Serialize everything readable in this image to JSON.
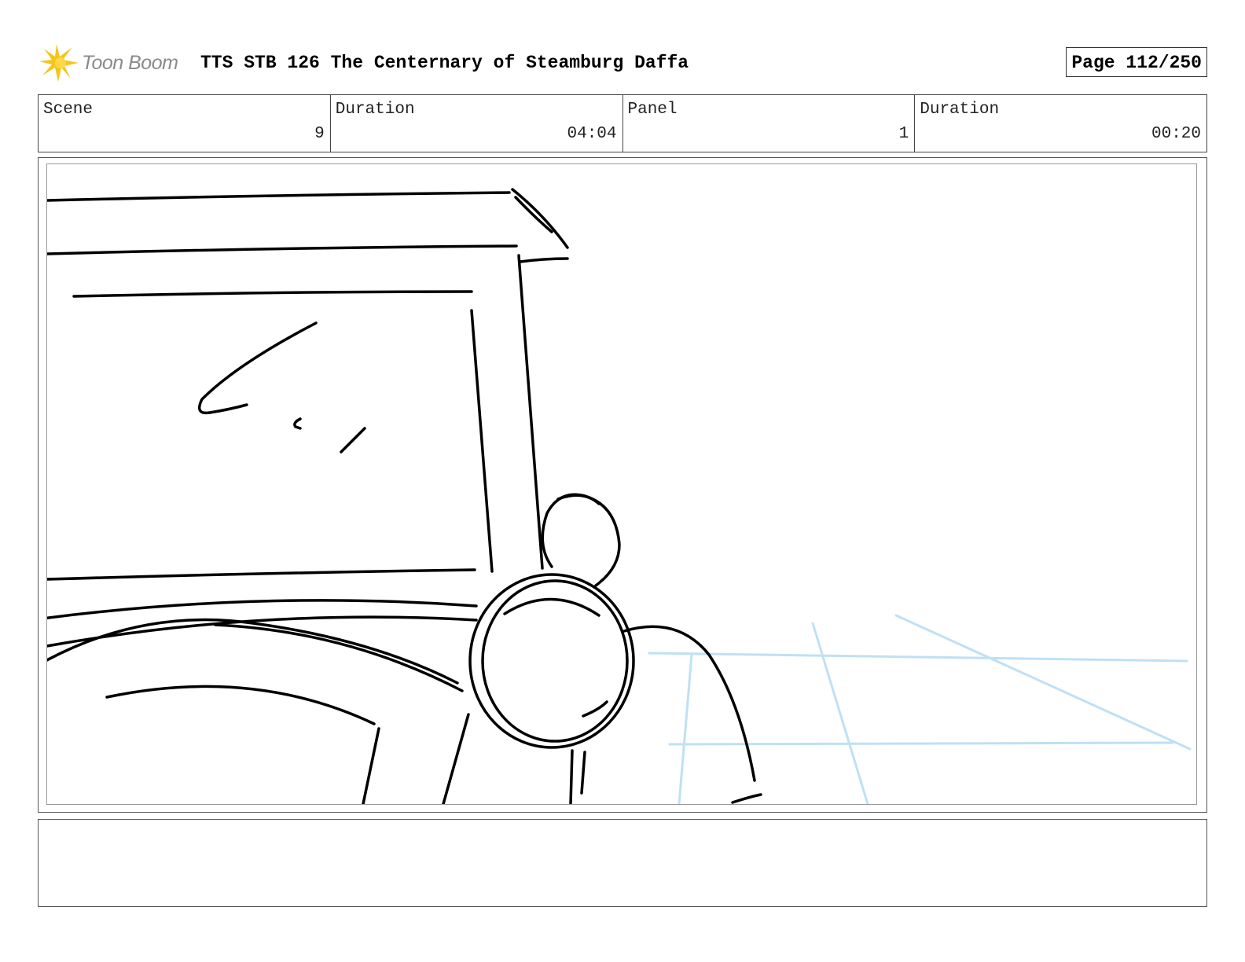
{
  "header": {
    "logo_text": "Toon Boom",
    "title": "TTS STB 126 The Centernary of Steamburg Daffa",
    "page_label": "Page 112/250"
  },
  "info": {
    "scene_label": "Scene",
    "scene_value": "9",
    "scene_duration_label": "Duration",
    "scene_duration_value": "04:04",
    "panel_label": "Panel",
    "panel_value": "1",
    "panel_duration_label": "Duration",
    "panel_duration_value": "00:20"
  },
  "colors": {
    "logo_yellow": "#f5c518",
    "sketch_line": "#000000",
    "guide_line": "#bfe0f5"
  },
  "icons": {
    "logo": "toon-boom-starburst-icon"
  }
}
